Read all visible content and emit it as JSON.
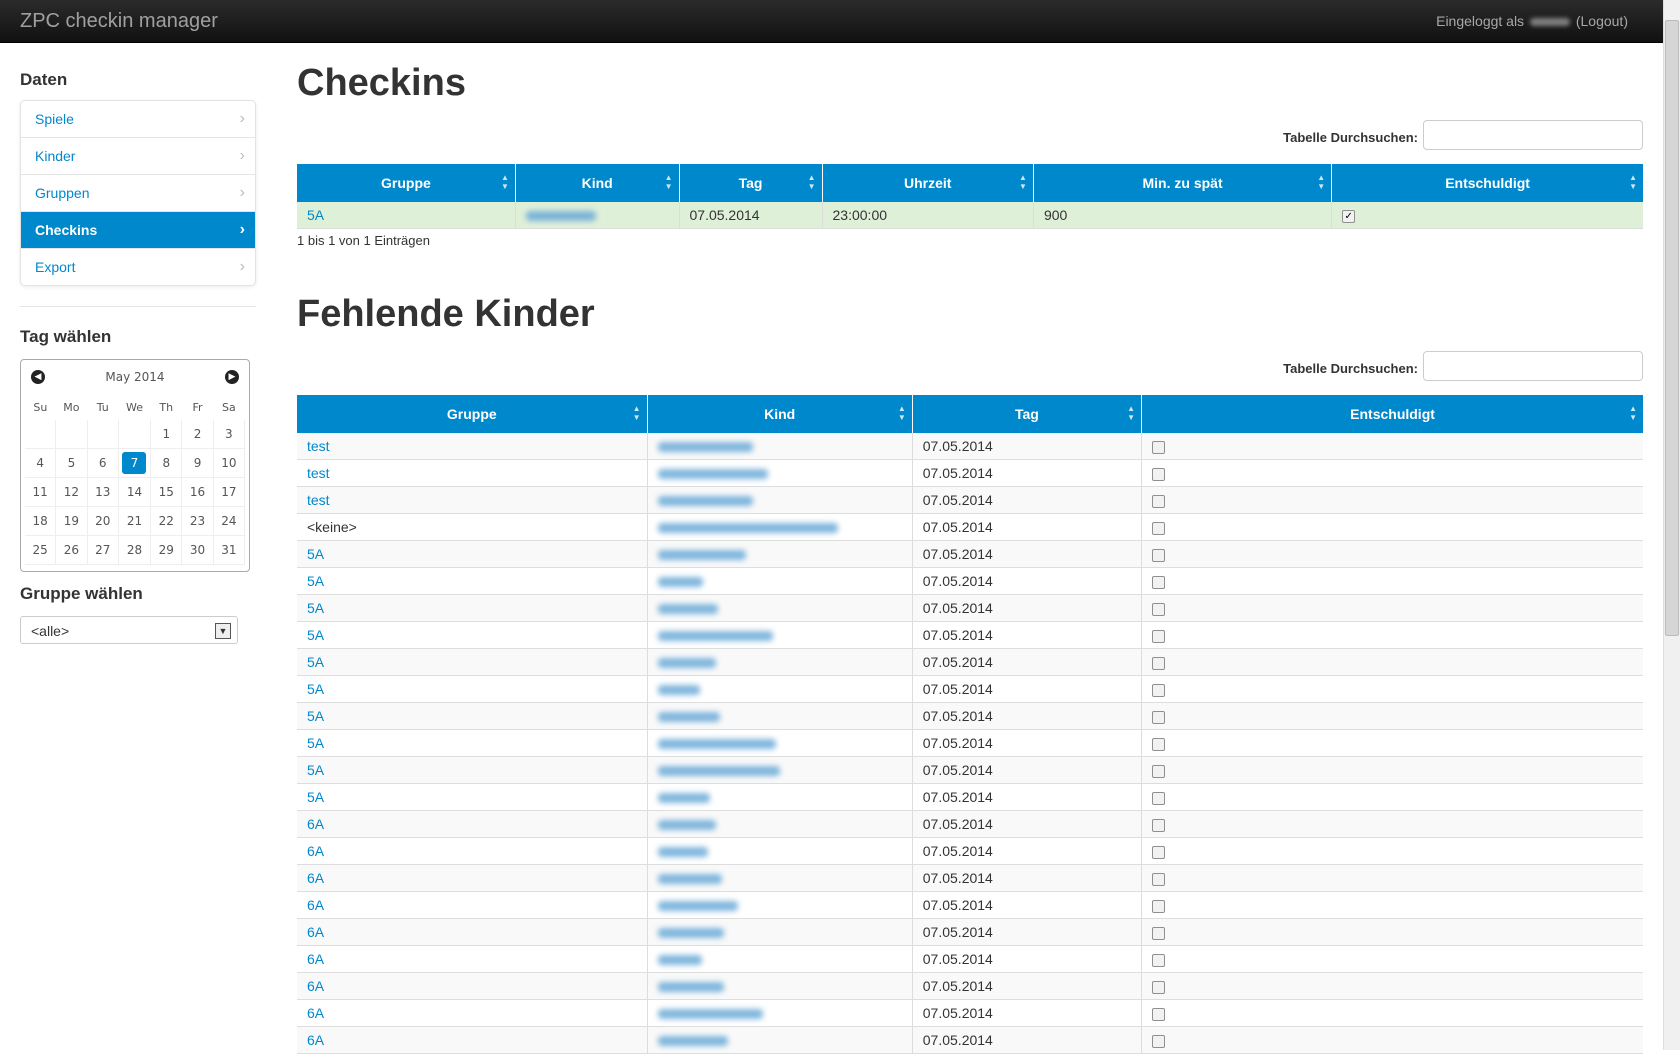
{
  "app": {
    "brand": "ZPC checkin manager",
    "login_prefix": "Eingeloggt als",
    "logout": "(Logout)"
  },
  "sidebar": {
    "data_heading": "Daten",
    "items": [
      {
        "label": "Spiele",
        "active": false
      },
      {
        "label": "Kinder",
        "active": false
      },
      {
        "label": "Gruppen",
        "active": false
      },
      {
        "label": "Checkins",
        "active": true
      },
      {
        "label": "Export",
        "active": false
      }
    ],
    "day_heading": "Tag wählen",
    "calendar": {
      "month": "May 2014",
      "weekdays": [
        "Su",
        "Mo",
        "Tu",
        "We",
        "Th",
        "Fr",
        "Sa"
      ],
      "weeks": [
        [
          "",
          "",
          "",
          "",
          "1",
          "2",
          "3"
        ],
        [
          "4",
          "5",
          "6",
          "7",
          "8",
          "9",
          "10"
        ],
        [
          "11",
          "12",
          "13",
          "14",
          "15",
          "16",
          "17"
        ],
        [
          "18",
          "19",
          "20",
          "21",
          "22",
          "23",
          "24"
        ],
        [
          "25",
          "26",
          "27",
          "28",
          "29",
          "30",
          "31"
        ]
      ],
      "selected": "7"
    },
    "group_heading": "Gruppe wählen",
    "group_select": "<alle>"
  },
  "checkins": {
    "title": "Checkins",
    "search_label": "Tabelle Durchsuchen:",
    "columns": [
      "Gruppe",
      "Kind",
      "Tag",
      "Uhrzeit",
      "Min. zu spät",
      "Entschuldigt"
    ],
    "rows": [
      {
        "gruppe": "5A",
        "tag": "07.05.2014",
        "uhrzeit": "23:00:00",
        "min": "900",
        "checked": true
      }
    ],
    "info": "1 bis 1 von 1 Einträgen"
  },
  "missing": {
    "title": "Fehlende Kinder",
    "search_label": "Tabelle Durchsuchen:",
    "columns": [
      "Gruppe",
      "Kind",
      "Tag",
      "Entschuldigt"
    ],
    "rows": [
      {
        "gruppe": "test",
        "tag": "07.05.2014",
        "link": true
      },
      {
        "gruppe": "test",
        "tag": "07.05.2014",
        "link": true
      },
      {
        "gruppe": "test",
        "tag": "07.05.2014",
        "link": true
      },
      {
        "gruppe": "<keine>",
        "tag": "07.05.2014",
        "link": false
      },
      {
        "gruppe": "5A",
        "tag": "07.05.2014",
        "link": true
      },
      {
        "gruppe": "5A",
        "tag": "07.05.2014",
        "link": true
      },
      {
        "gruppe": "5A",
        "tag": "07.05.2014",
        "link": true
      },
      {
        "gruppe": "5A",
        "tag": "07.05.2014",
        "link": true
      },
      {
        "gruppe": "5A",
        "tag": "07.05.2014",
        "link": true
      },
      {
        "gruppe": "5A",
        "tag": "07.05.2014",
        "link": true
      },
      {
        "gruppe": "5A",
        "tag": "07.05.2014",
        "link": true
      },
      {
        "gruppe": "5A",
        "tag": "07.05.2014",
        "link": true
      },
      {
        "gruppe": "5A",
        "tag": "07.05.2014",
        "link": true
      },
      {
        "gruppe": "5A",
        "tag": "07.05.2014",
        "link": true
      },
      {
        "gruppe": "6A",
        "tag": "07.05.2014",
        "link": true
      },
      {
        "gruppe": "6A",
        "tag": "07.05.2014",
        "link": true
      },
      {
        "gruppe": "6A",
        "tag": "07.05.2014",
        "link": true
      },
      {
        "gruppe": "6A",
        "tag": "07.05.2014",
        "link": true
      },
      {
        "gruppe": "6A",
        "tag": "07.05.2014",
        "link": true
      },
      {
        "gruppe": "6A",
        "tag": "07.05.2014",
        "link": true
      },
      {
        "gruppe": "6A",
        "tag": "07.05.2014",
        "link": true
      },
      {
        "gruppe": "6A",
        "tag": "07.05.2014",
        "link": true
      },
      {
        "gruppe": "6A",
        "tag": "07.05.2014",
        "link": true
      }
    ]
  }
}
